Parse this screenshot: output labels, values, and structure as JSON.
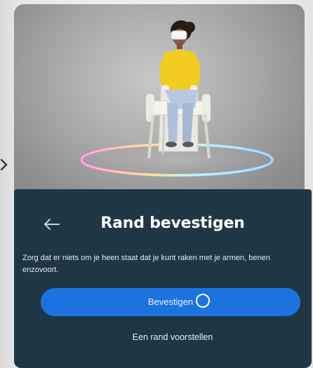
{
  "dialog": {
    "title": "Rand bevestigen",
    "description": "Zorg dat er niets om je heen staat dat je kunt raken met je armen, benen enzovoort.",
    "confirm_label": "Bevestigen",
    "suggest_label": "Een rand voorstellen"
  },
  "icons": {
    "back": "back-arrow-icon",
    "cursor": "pointer-ring-icon",
    "outside_arrow": "chevron-right-icon"
  },
  "colors": {
    "panel_background": "#1f3645",
    "primary_button": "#1c73e0",
    "avatar_shirt": "#f2cd1f",
    "boundary_ring_pink": "#ff7fd0",
    "boundary_ring_blue": "#7fc8ff"
  }
}
